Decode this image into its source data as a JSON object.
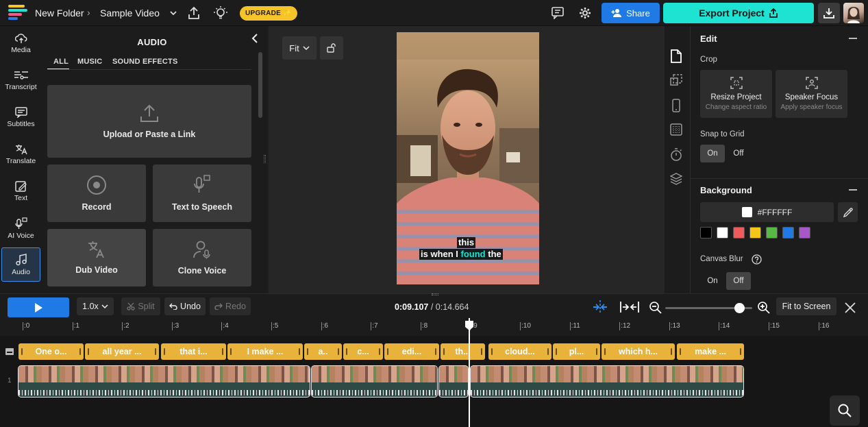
{
  "header": {
    "folder": "New Folder",
    "project": "Sample Video",
    "upgrade": "UPGRADE ✨",
    "share": "Share",
    "export": "Export Project"
  },
  "leftnav": {
    "items": [
      {
        "label": "Media",
        "icon": "cloud-upload-icon"
      },
      {
        "label": "Transcript",
        "icon": "transcript-icon"
      },
      {
        "label": "Subtitles",
        "icon": "subtitles-icon"
      },
      {
        "label": "Translate",
        "icon": "translate-icon"
      },
      {
        "label": "Text",
        "icon": "text-edit-icon"
      },
      {
        "label": "AI Voice",
        "icon": "ai-voice-icon"
      },
      {
        "label": "Audio",
        "icon": "music-note-icon",
        "active": true
      }
    ]
  },
  "audio": {
    "title": "AUDIO",
    "tabs": [
      "ALL",
      "MUSIC",
      "SOUND EFFECTS"
    ],
    "upload": "Upload or Paste a Link",
    "record": "Record",
    "tts": "Text to Speech",
    "dub": "Dub Video",
    "clone": "Clone Voice"
  },
  "canvas": {
    "fit": "Fit",
    "caption_line1": "this",
    "caption_line2a": "is when I",
    "caption_highlight": "found",
    "caption_line2b": "the",
    "highlight_color": "#1ee3d3"
  },
  "edit": {
    "title": "Edit",
    "crop": "Crop",
    "resize_title": "Resize Project",
    "resize_sub": "Change aspect ratio",
    "speaker_title": "Speaker Focus",
    "speaker_sub": "Apply speaker focus",
    "snap": "Snap to Grid",
    "on": "On",
    "off": "Off",
    "background": "Background",
    "bg_hex": "#FFFFFF",
    "swatches": [
      "#000000",
      "#FFFFFF",
      "#F05A5A",
      "#F5C518",
      "#57B846",
      "#1F7AE6",
      "#A657C8"
    ],
    "canvas_blur": "Canvas Blur",
    "blur_on": "On",
    "blur_off": "Off"
  },
  "playback": {
    "speed": "1.0x",
    "split": "Split",
    "undo": "Undo",
    "redo": "Redo",
    "time_current": "0:09.107",
    "time_total": "/ 0:14.664",
    "fit_screen": "Fit to Screen",
    "zoom_level": 0.85
  },
  "timeline": {
    "ticks": [
      ":0",
      ":1",
      ":2",
      ":3",
      ":4",
      ":5",
      ":6",
      ":7",
      ":8",
      ":9",
      ":10",
      ":11",
      ":12",
      ":13",
      ":14",
      ":15",
      ":16"
    ],
    "captions": [
      "One o...",
      "all year ...",
      "that i...",
      "I make ...",
      "a..",
      "c...",
      "edi...",
      "th...",
      "cloud...",
      "pl...",
      "which h...",
      "make ..."
    ],
    "track_label": "1"
  }
}
